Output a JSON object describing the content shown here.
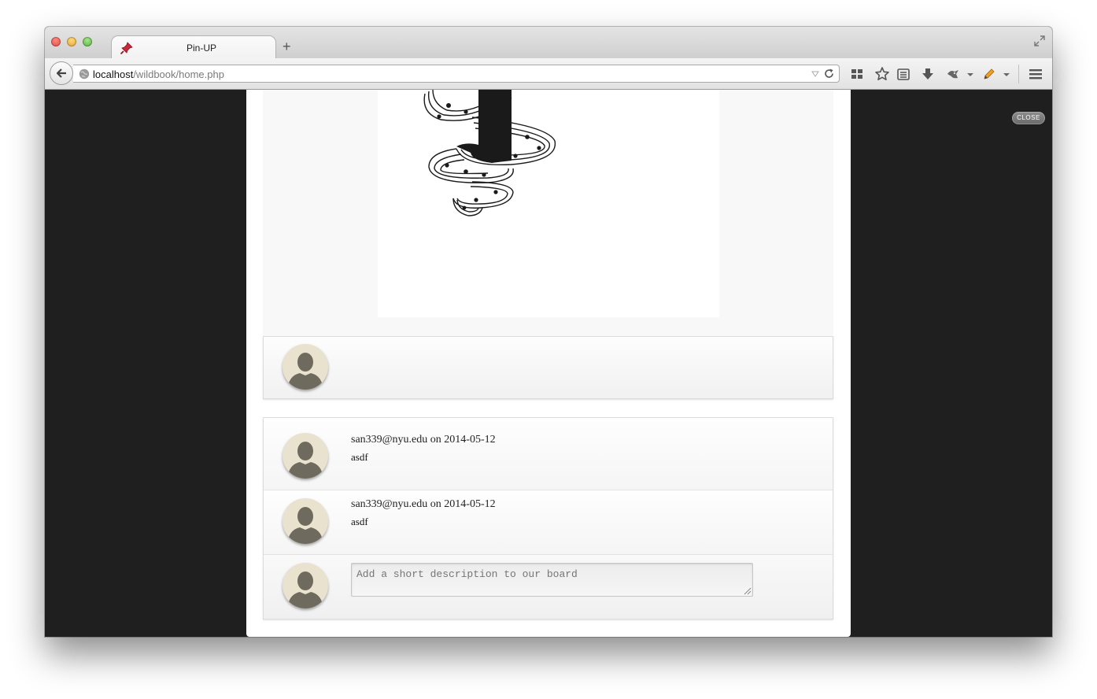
{
  "browser": {
    "tab_title": "Pin-UP",
    "new_tab_label": "+",
    "url_host": "localhost",
    "url_path": "/wildbook/home.php",
    "icons": [
      "pin-icon",
      "back-arrow-icon",
      "globe-icon",
      "reload-icon",
      "bookmarks-grid-icon",
      "star-icon",
      "reading-list-icon",
      "download-icon",
      "addon-icon",
      "pencil-icon",
      "menu-icon"
    ]
  },
  "overlay": {
    "close_label": "CLOSE"
  },
  "comments": [
    {
      "author": "san339@nyu.edu",
      "on": "on",
      "date": "2014-05-12",
      "text": "asdf"
    },
    {
      "author": "san339@nyu.edu",
      "on": "on",
      "date": "2014-05-12",
      "text": "asdf"
    }
  ],
  "comment_form": {
    "placeholder": "Add a short description to our board"
  },
  "colors": {
    "backdrop": "#1f1f1f",
    "panel": "#ffffff",
    "avatar_bg": "#e9e2cf",
    "avatar_silhouette": "#6f6a5e"
  }
}
